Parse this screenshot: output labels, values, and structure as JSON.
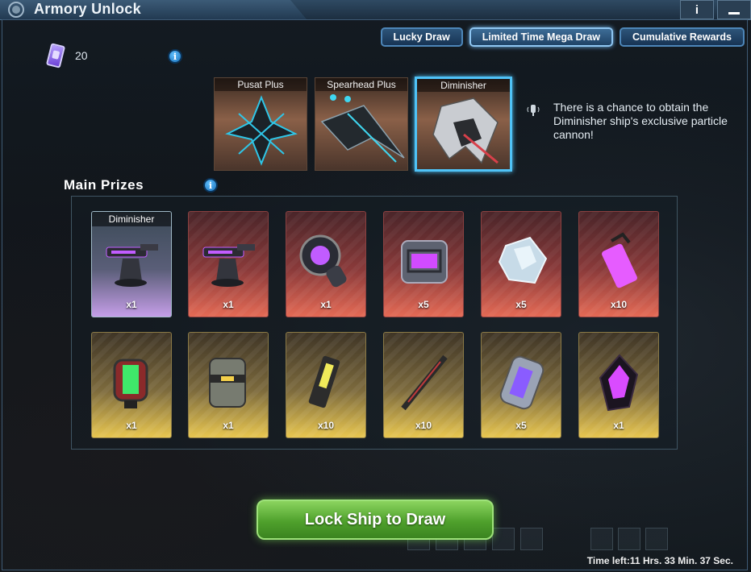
{
  "window": {
    "title": "Armory Unlock",
    "info_btn": "i",
    "logo": "gear-logo-icon"
  },
  "tabs": [
    {
      "label": "Lucky Draw",
      "active": false
    },
    {
      "label": "Limited Time Mega Draw",
      "active": true
    },
    {
      "label": "Cumulative Rewards",
      "active": false
    }
  ],
  "currency": {
    "icon": "ticket-icon",
    "count": "20"
  },
  "ships": [
    {
      "name": "Pusat Plus",
      "selected": false,
      "color": "#2ec6e8"
    },
    {
      "name": "Spearhead Plus",
      "selected": false,
      "color": "#3fd6f0"
    },
    {
      "name": "Diminisher",
      "selected": true,
      "color": "#d8404a"
    }
  ],
  "hint": {
    "icon": "speaker-icon",
    "text": "There is a chance to obtain the Diminisher ship's exclusive particle cannon!"
  },
  "main_prizes": {
    "title": "Main Prizes",
    "row1": [
      {
        "label": "Diminisher",
        "qty": "x1",
        "rarity": "purple",
        "icon": "particle-cannon-icon"
      },
      {
        "label": "",
        "qty": "x1",
        "rarity": "red",
        "icon": "particle-cannon-icon"
      },
      {
        "label": "",
        "qty": "x1",
        "rarity": "red",
        "icon": "core-module-icon"
      },
      {
        "label": "",
        "qty": "x5",
        "rarity": "red",
        "icon": "supply-crate-icon"
      },
      {
        "label": "",
        "qty": "x5",
        "rarity": "red",
        "icon": "crystal-icon"
      },
      {
        "label": "",
        "qty": "x10",
        "rarity": "red",
        "icon": "energy-cell-icon"
      }
    ],
    "row2": [
      {
        "label": "",
        "qty": "x1",
        "rarity": "gold",
        "icon": "green-canister-icon"
      },
      {
        "label": "",
        "qty": "x1",
        "rarity": "gold",
        "icon": "barrel-icon"
      },
      {
        "label": "",
        "qty": "x10",
        "rarity": "gold",
        "icon": "blueprint-card-icon"
      },
      {
        "label": "",
        "qty": "x10",
        "rarity": "gold",
        "icon": "rifle-part-icon"
      },
      {
        "label": "",
        "qty": "x5",
        "rarity": "gold",
        "icon": "battery-pack-icon"
      },
      {
        "label": "",
        "qty": "x1",
        "rarity": "gold",
        "icon": "dark-crystal-icon"
      }
    ]
  },
  "lock_button": "Lock Ship to Draw",
  "timer": "Time left:11 Hrs. 33 Min. 37 Sec."
}
